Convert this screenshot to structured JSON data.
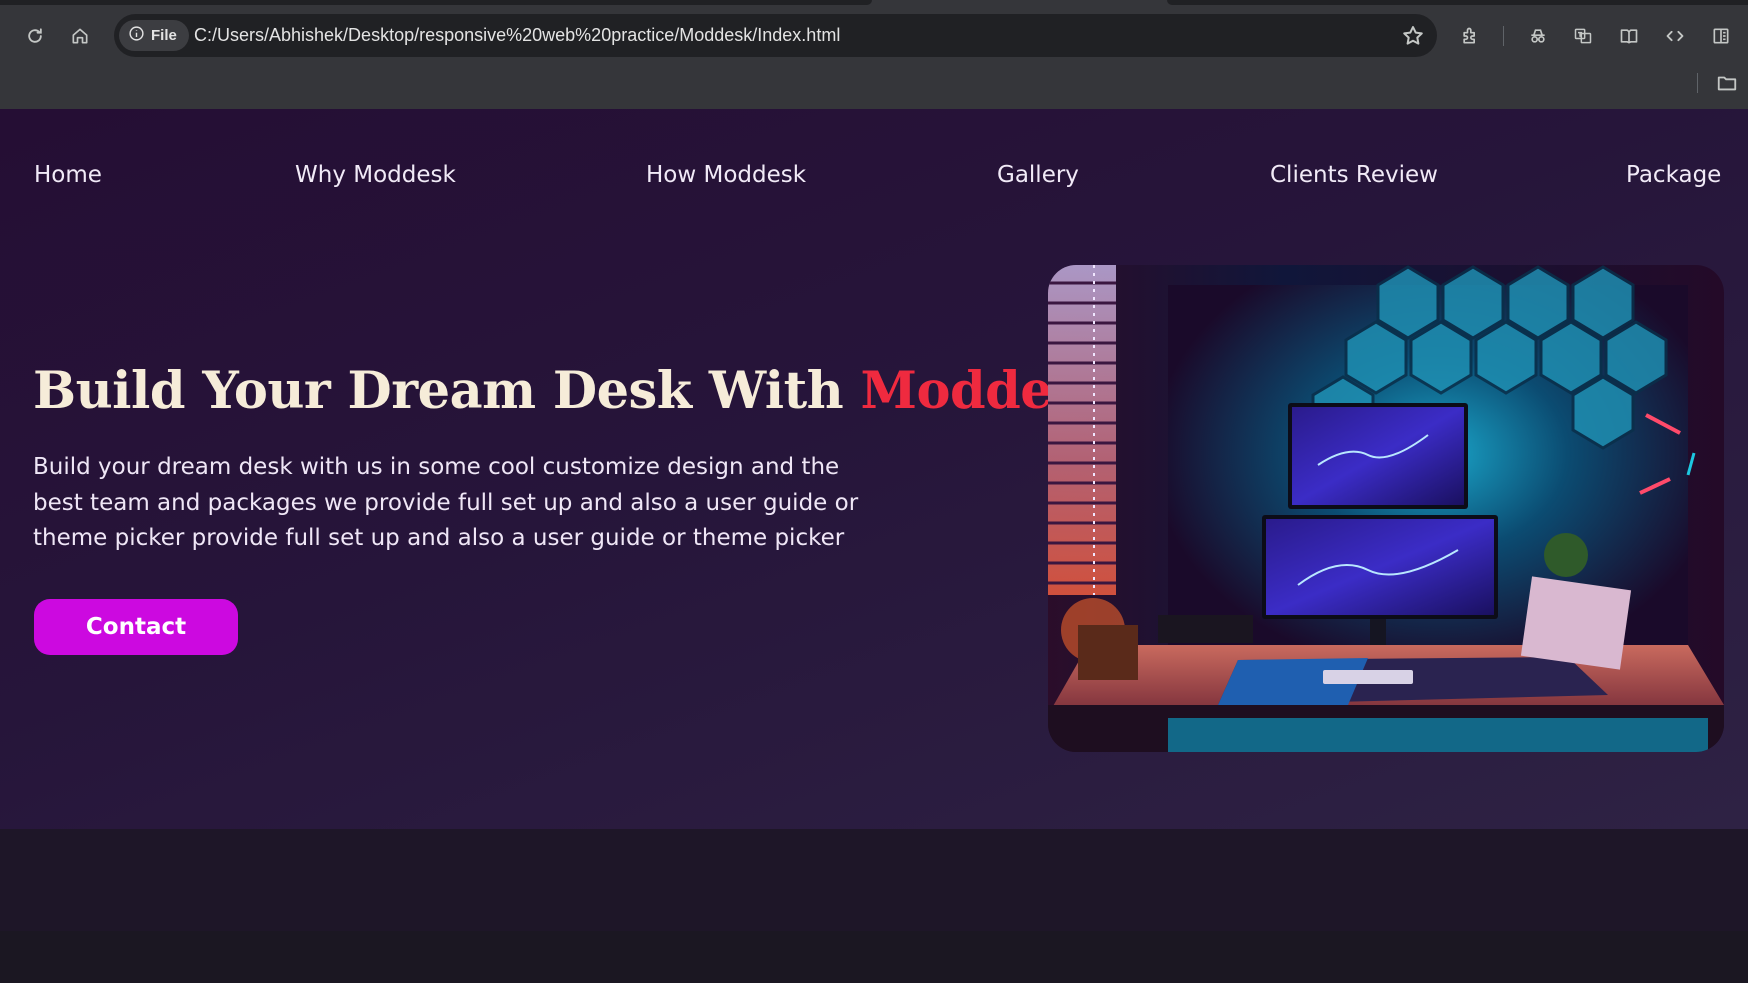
{
  "browser": {
    "security_chip": "File",
    "url": "C:/Users/Abhishek/Desktop/responsive%20web%20practice/Moddesk/Index.html",
    "icons": [
      "reload-icon",
      "home-icon",
      "info-icon",
      "star-icon",
      "extensions-icon",
      "incognito-icon",
      "translate-icon",
      "reading-mode-icon",
      "devtools-icon",
      "sidebar-icon",
      "folder-icon"
    ]
  },
  "nav": {
    "items": [
      "Home",
      "Why Moddesk",
      "How Moddesk",
      "Gallery",
      "Clients Review",
      "Package"
    ]
  },
  "hero": {
    "headline_lead": "Build Your Dream Desk With ",
    "headline_accent": "Moddesk",
    "intro": "Build your dream desk with us in some cool customize design and the best team and packages we provide full set up and also a user guide or theme picker provide full set up and also a user guide or theme picker",
    "cta_label": "Contact"
  },
  "colors": {
    "page_background": "#26153a",
    "accent_red": "#ef2a3f",
    "button": "#cc09e0",
    "headline": "#f6ecd9"
  }
}
